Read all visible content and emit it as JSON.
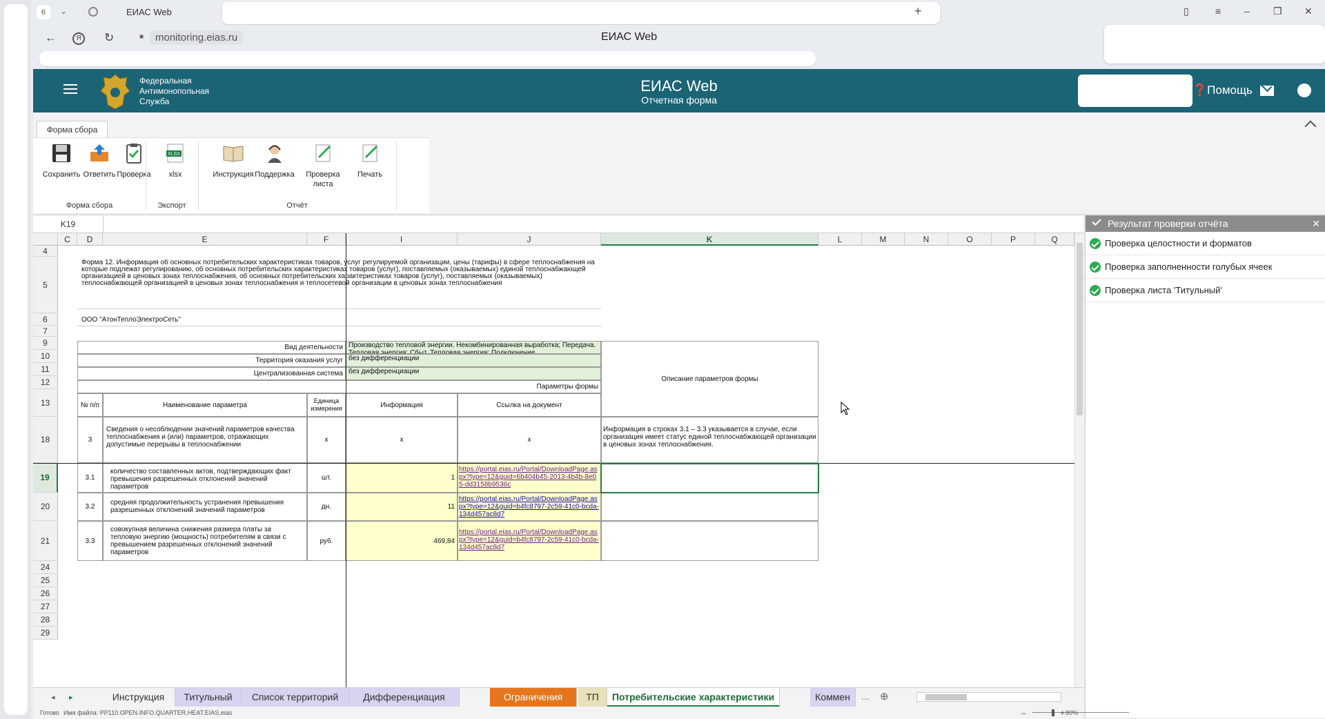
{
  "browser": {
    "tab_count": "6",
    "tab_title": "ЕИАС Web",
    "url": "monitoring.eias.ru",
    "page_title": "ЕИАС Web"
  },
  "header": {
    "org_line1": "Федеральная",
    "org_line2": "Антимонопольная",
    "org_line3": "Служба",
    "title": "ЕИАС Web",
    "subtitle": "Отчетная форма",
    "help_label": "Помощь",
    "accent_color": "#1b6476"
  },
  "ribbon": {
    "tab_label": "Форма сбора",
    "buttons": {
      "save": "Сохранить",
      "reply": "Ответить",
      "check": "Проверка",
      "xlsx": "xlsx",
      "instruction": "Инструкция",
      "support": "Поддержка",
      "sheet_check_1": "Проверка",
      "sheet_check_2": "листа",
      "print": "Печать"
    },
    "groups": {
      "form": "Форма сбора",
      "export": "Экспорт",
      "report": "Отчёт"
    }
  },
  "formula_bar": {
    "cell_ref": "K19",
    "value": ""
  },
  "grid": {
    "columns": [
      "C",
      "D",
      "E",
      "F",
      "I",
      "J",
      "K",
      "L",
      "M",
      "N",
      "O",
      "P",
      "Q"
    ],
    "rows": [
      "4",
      "5",
      "6",
      "7",
      "9",
      "10",
      "11",
      "12",
      "13",
      "18",
      "19",
      "20",
      "21",
      "24",
      "25",
      "26",
      "27",
      "28",
      "29"
    ],
    "selected_cell": "K19"
  },
  "form": {
    "title": "Форма 12. Информация об основных потребительских характеристиках товаров, услуг регулируемой организации, цены (тарифы) в сфере теплоснабжения на которые подлежат регулированию, об основных потребительских характеристиках товаров (услуг), поставляемых (оказываемых) единой теплоснабжающей организацией в ценовых зонах теплоснабжения, об основных потребительских характеристиках товаров (услуг), поставляемых (оказываемых) теплоснабжающей организацией в ценовых зонах теплоснабжения и теплосетевой организации в ценовых зонах теплоснабжения",
    "organization": "ООО \"АтонТеплоЭлектроСеть\"",
    "param_labels": {
      "activity": "Вид деятельности",
      "territory": "Территория оказания услуг",
      "system": "Централизованная система",
      "params": "Параметры формы"
    },
    "param_values": {
      "activity": "Производство тепловой энергии. Некомбинированная выработка; Передача. Тепловая энергия; Сбыт. Тепловая энергия; Подключение",
      "territory": "без дифференциации",
      "system": "без дифференциации"
    },
    "description_header": "Описание параметров формы",
    "table_headers": {
      "num": "№ п/п",
      "name": "Наименование параметра",
      "unit": "Единица измерения",
      "info": "Информация",
      "link": "Ссылка на документ"
    },
    "rows": [
      {
        "num": "3",
        "name": "Сведения о несоблюдении значений параметров качества теплоснабжения и (или) параметров, отражающих допустимые перерывы в теплоснабжении",
        "unit": "x",
        "info": "x",
        "link": "x",
        "description": "Информация в строках 3.1 – 3.3 указывается в случае, если организация имеет статус единой теплоснабжающей организации в ценовых зонах теплоснабжения."
      },
      {
        "num": "3.1",
        "name": "количество составленных актов, подтверждающих факт превышения разрешенных отклонений значений параметров",
        "unit": "шт.",
        "info": "1",
        "link": "https://portal.eias.ru/Portal/DownloadPage.aspx?type=12&guid=6b404b45-2013-4b4b-8e05-dd3158b9536c",
        "description": ""
      },
      {
        "num": "3.2",
        "name": "средняя продолжительность устранения превышения разрешенных отклонений значений параметров",
        "unit": "дн.",
        "info": "11",
        "link": "https://portal.eias.ru/Portal/DownloadPage.aspx?type=12&guid=b4fc8797-2c59-41c0-bcda-134d457ac8d7",
        "description": ""
      },
      {
        "num": "3.3",
        "name": "совокупная величина снижения размера платы за тепловую энергию (мощность) потребителям в связи с превышением разрешенных отклонений значений параметров",
        "unit": "руб.",
        "info": "469,84",
        "link": "https://portal.eias.ru/Portal/DownloadPage.aspx?type=12&guid=b4fc8797-2c59-41c0-bcda-134d457ac8d7",
        "description": ""
      }
    ]
  },
  "side_panel": {
    "title": "Результат проверки отчёта",
    "items": [
      "Проверка целостности и форматов",
      "Проверка заполненности голубых ячеек",
      "Проверка листа 'Титульный'"
    ]
  },
  "sheet_tabs": [
    {
      "label": "Инструкция",
      "color": "#f3f3f3"
    },
    {
      "label": "Титульный",
      "color": "#d9d2f0"
    },
    {
      "label": "Список территорий",
      "color": "#d9d2f0"
    },
    {
      "label": "Дифференциация",
      "color": "#d9d2f0"
    },
    {
      "label": "Ограничения",
      "color": "#e5761d"
    },
    {
      "label": "ТП",
      "color": "#e8e0b8"
    },
    {
      "label": "Потребительские характеристики",
      "color": "#ffffff"
    },
    {
      "label": "Коммен",
      "color": "#d9d2f0"
    }
  ],
  "tabs_more": "...",
  "status": {
    "ready": "Готово",
    "filename": "Имя файла: PP110.OPEN.INFO.QUARTER.HEAT.EIAS.eias",
    "zoom": "90%"
  }
}
